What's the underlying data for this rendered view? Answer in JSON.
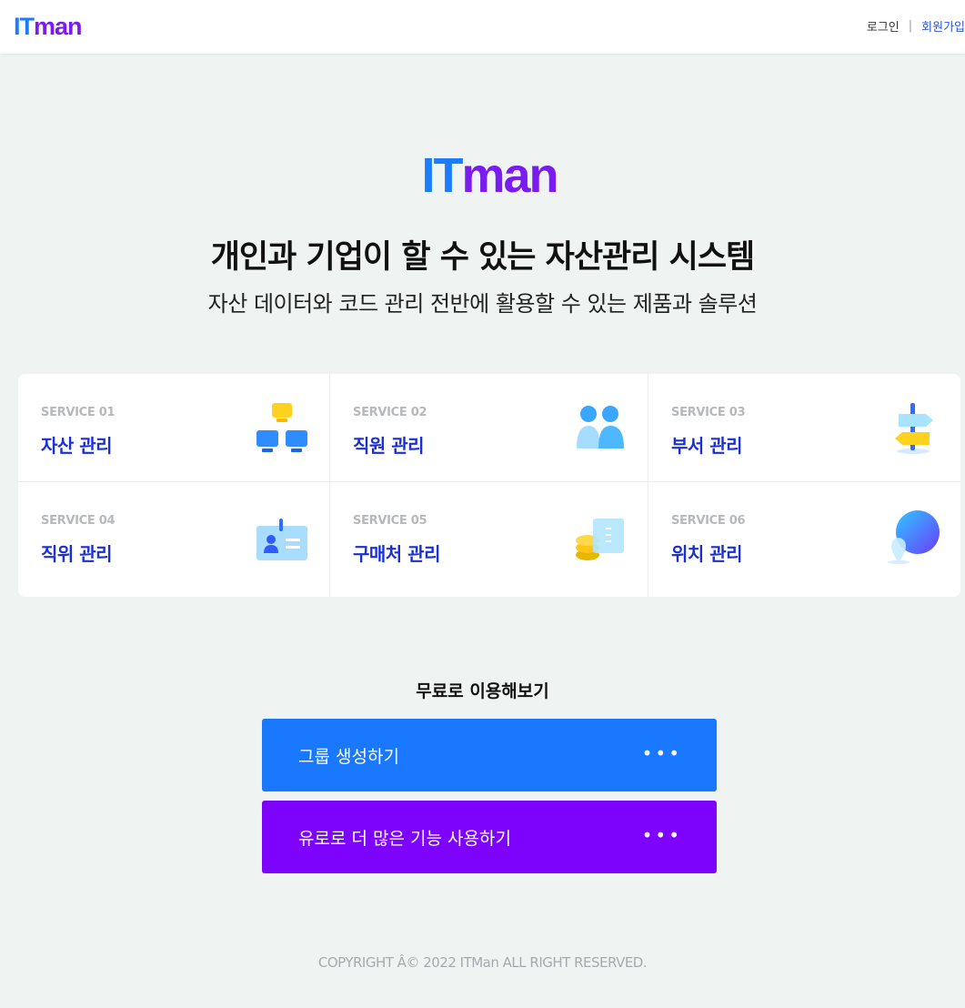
{
  "header": {
    "logo_it": "IT",
    "logo_man": "man",
    "login": "로그인",
    "separator": "|",
    "signup": "회원가입"
  },
  "hero": {
    "logo_it": "IT",
    "logo_man": "man",
    "title": "개인과 기업이 할 수 있는 자산관리 시스템",
    "subtitle": "자산 데이터와 코드 관리 전반에 활용할 수 있는 제품과 솔루션"
  },
  "services": [
    {
      "label": "SERVICE 01",
      "title": "자산 관리",
      "icon": "network-monitors-icon"
    },
    {
      "label": "SERVICE 02",
      "title": "직원 관리",
      "icon": "people-icon"
    },
    {
      "label": "SERVICE 03",
      "title": "부서 관리",
      "icon": "signpost-icon"
    },
    {
      "label": "SERVICE 04",
      "title": "직위 관리",
      "icon": "id-card-icon"
    },
    {
      "label": "SERVICE 05",
      "title": "구매처 관리",
      "icon": "coins-receipt-icon"
    },
    {
      "label": "SERVICE 06",
      "title": "위치 관리",
      "icon": "location-pin-icon"
    }
  ],
  "free": {
    "title": "무료로 이용해보기",
    "cta1": "그룹 생성하기",
    "cta2": "유로로 더 많은 기능 사용하기",
    "dots": "•••"
  },
  "footer": {
    "copyright": "COPYRIGHT Â© 2022 ITMan ALL RIGHT RESERVED."
  },
  "colors": {
    "brand_blue": "#1a78ff",
    "brand_purple": "#7e03fc",
    "service_title": "#1a2fd6",
    "background": "#eff4f3"
  }
}
